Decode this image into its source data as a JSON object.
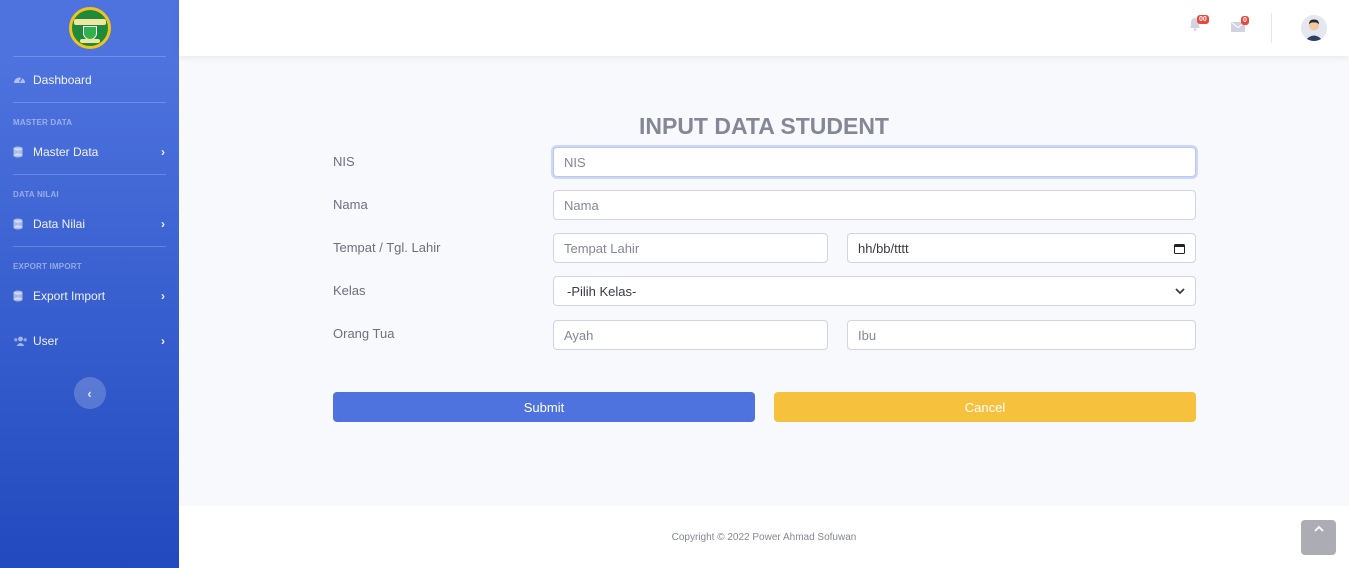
{
  "sidebar": {
    "dashboard": "Dashboard",
    "headings": [
      "MASTER DATA",
      "DATA NILAI",
      "EXPORT IMPORT"
    ],
    "items": [
      {
        "label": "Master Data",
        "icon": "database-icon"
      },
      {
        "label": "Data Nilai",
        "icon": "database-icon"
      },
      {
        "label": "Export Import",
        "icon": "database-icon"
      },
      {
        "label": "User",
        "icon": "users-icon"
      }
    ],
    "toggle_glyph": "‹"
  },
  "topbar": {
    "alerts_count": "00",
    "messages_count": "0"
  },
  "form": {
    "title": "INPUT DATA STUDENT",
    "labels": {
      "nis": "NIS",
      "nama": "Nama",
      "ttl": "Tempat / Tgl. Lahir",
      "kelas": "Kelas",
      "ortu": "Orang Tua"
    },
    "placeholders": {
      "nis": "NIS",
      "nama": "Nama",
      "tempat": "Tempat Lahir",
      "tanggal": "hh/bb/tttt",
      "ayah": "Ayah",
      "ibu": "Ibu"
    },
    "kelas_selected": "-Pilih Kelas-",
    "submit": "Submit",
    "cancel": "Cancel"
  },
  "footer": {
    "copyright": "Copyright © 2022 Power Ahmad Sofuwan"
  },
  "colors": {
    "primary": "#4e73df",
    "warning": "#f6c23e",
    "danger": "#e74a3b"
  }
}
